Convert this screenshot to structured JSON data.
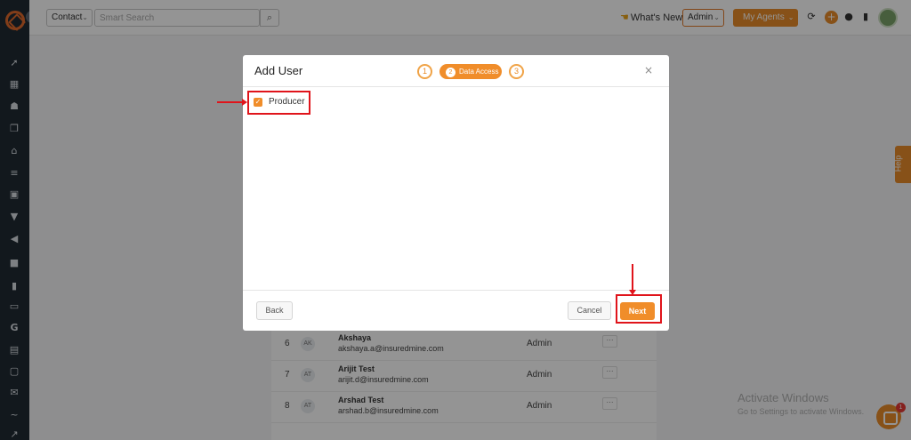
{
  "topbar": {
    "contact_select": "Contact",
    "search_placeholder": "Smart Search",
    "whats_new": "What's New",
    "role_select": "Admin",
    "agents_button": "My Agents"
  },
  "icons": {
    "sidebar": [
      "rocket-icon",
      "dashboard-icon",
      "contacts-icon",
      "pipeline-icon",
      "bank-icon",
      "list-icon",
      "account-icon",
      "funnel-icon",
      "megaphone-icon",
      "docs-icon",
      "reports-icon",
      "folder-icon",
      "google-icon",
      "calculator-icon",
      "calendar-icon",
      "mail-icon",
      "signature-icon",
      "trend-icon"
    ],
    "topbar": [
      "search-icon",
      "refresh-icon",
      "plus-icon",
      "bell-icon",
      "phone-icon",
      "avatar"
    ]
  },
  "background": {
    "rows": [
      {
        "num": "6",
        "initials": "AK",
        "name": "Akshaya",
        "email": "akshaya.a@insuredmine.com",
        "role": "Admin",
        "more": "···"
      },
      {
        "num": "7",
        "initials": "AT",
        "name": "Arijit Test",
        "email": "arijit.d@insuredmine.com",
        "role": "Admin",
        "more": "···"
      },
      {
        "num": "8",
        "initials": "AT",
        "name": "Arshad Test",
        "email": "arshad.b@insuredmine.com",
        "role": "Admin",
        "more": "···"
      }
    ],
    "help_tab": "Help",
    "watermark_title": "Activate Windows",
    "watermark_sub": "Go to Settings to activate Windows.",
    "chat_badge": "1"
  },
  "modal": {
    "title": "Add User",
    "steps": [
      {
        "num": "1",
        "label": ""
      },
      {
        "num": "2",
        "label": "Data Access"
      },
      {
        "num": "3",
        "label": ""
      }
    ],
    "close": "×",
    "checkbox_label": "Producer",
    "checkbox_checked": true,
    "back_label": "Back",
    "cancel_label": "Cancel",
    "next_label": "Next"
  },
  "colors": {
    "accent": "#f08d2a",
    "sidebar": "#1f2a33",
    "annotation": "#e0141b"
  }
}
